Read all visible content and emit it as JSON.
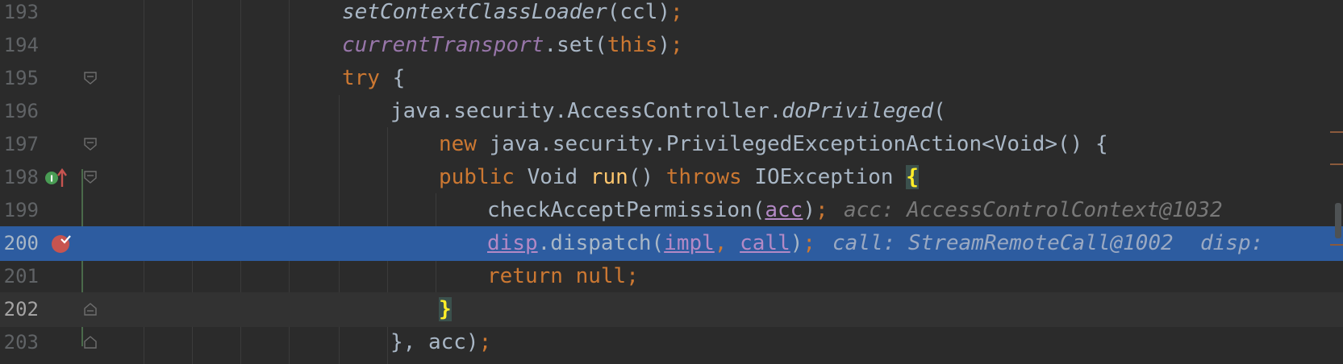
{
  "editor": {
    "lines": [
      {
        "num": "193"
      },
      {
        "num": "194"
      },
      {
        "num": "195"
      },
      {
        "num": "196"
      },
      {
        "num": "197"
      },
      {
        "num": "198"
      },
      {
        "num": "199"
      },
      {
        "num": "200"
      },
      {
        "num": "201"
      },
      {
        "num": "202"
      },
      {
        "num": "203"
      }
    ],
    "tokens": {
      "l193_a": "setContextClassLoader",
      "l193_b": "(ccl)",
      "l193_c": ";",
      "l194_a": "currentTransport",
      "l194_b": ".set(",
      "l194_c": "this",
      "l194_d": ")",
      "l194_e": ";",
      "l195_a": "try",
      "l195_b": " {",
      "l196_a": "java.security.AccessController.",
      "l196_b": "doPrivileged",
      "l196_c": "(",
      "l197_a": "new",
      "l197_b": " java.security.PrivilegedExceptionAction<Void>() {",
      "l198_a": "public",
      "l198_b": " Void ",
      "l198_c": "run",
      "l198_d": "() ",
      "l198_e": "throws",
      "l198_f": " IOException ",
      "l198_g": "{",
      "l199_a": "checkAcceptPermission(",
      "l199_b": "acc",
      "l199_c": ")",
      "l199_d": ";",
      "l199_hint": "acc: AccessControlContext@1032",
      "l200_a": "disp",
      "l200_b": ".dispatch(",
      "l200_c": "impl",
      "l200_d": ", ",
      "l200_e": "call",
      "l200_f": ")",
      "l200_g": ";",
      "l200_hint1": "call: StreamRemoteCall@1002",
      "l200_hint2": "disp:",
      "l201_a": "return",
      "l201_b": " null",
      "l201_c": ";",
      "l202_a": "}",
      "l203_a": "}, acc)",
      "l203_b": ";"
    }
  },
  "colors": {
    "background": "#2b2b2b",
    "execution_line": "#2d5ca0",
    "keyword": "#cc7832",
    "method": "#ffc66d",
    "field": "#9876aa",
    "breakpoint": "#c75450"
  },
  "icons": {
    "breakpoint": "breakpoint-verified-icon",
    "implements": "implements-method-icon",
    "fold": "fold-marker-icon"
  }
}
